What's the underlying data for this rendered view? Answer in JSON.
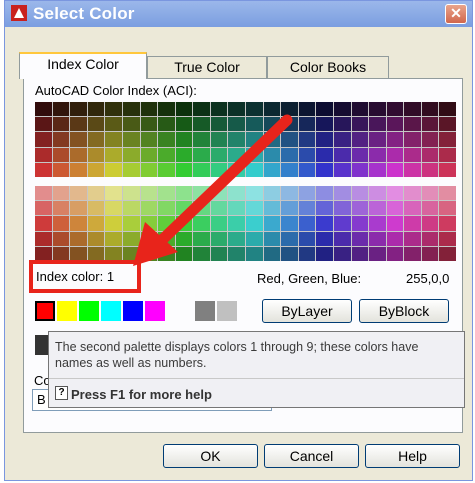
{
  "window": {
    "title": "Select Color"
  },
  "tabs": [
    {
      "label": "Index Color"
    },
    {
      "label": "True Color"
    },
    {
      "label": "Color Books"
    }
  ],
  "aci_label": "AutoCAD Color Index (ACI):",
  "index_color": {
    "label": "Index color:",
    "value": "1"
  },
  "rgb": {
    "label": "Red, Green, Blue:",
    "value": "255,0,0"
  },
  "buttons": {
    "bylayer": "ByLayer",
    "byblock": "ByBlock",
    "ok": "OK",
    "cancel": "Cancel",
    "help": "Help"
  },
  "tooltip": {
    "text": "The second palette displays colors 1 through 9; these colors have names as well as numbers.",
    "help": "Press F1 for more help"
  },
  "color_field": {
    "label_partial": "Co",
    "value_partial": "B"
  },
  "colors": {
    "accent_highlight": "#e8241b",
    "arrow": "#e8241b"
  }
}
